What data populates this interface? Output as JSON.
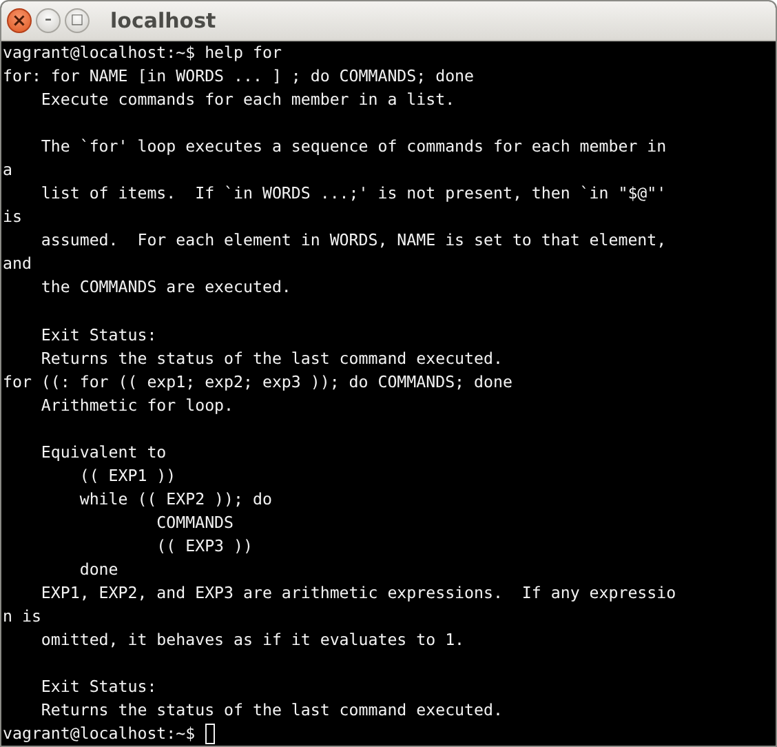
{
  "window": {
    "title": "localhost",
    "buttons": [
      {
        "kind": "close",
        "label": "×"
      },
      {
        "kind": "minimize",
        "label": "–"
      },
      {
        "kind": "maximize",
        "label": "□"
      }
    ]
  },
  "terminal": {
    "lines": [
      {
        "kind": "prompt",
        "text": "vagrant@localhost:~$ help for",
        "cursor": false
      },
      {
        "kind": "text",
        "text": "for: for NAME [in WORDS ... ] ; do COMMANDS; done"
      },
      {
        "kind": "text",
        "text": "    Execute commands for each member in a list."
      },
      {
        "kind": "blank"
      },
      {
        "kind": "text",
        "text": "    The `for' loop executes a sequence of commands for each member in"
      },
      {
        "kind": "text",
        "text": "a"
      },
      {
        "kind": "text",
        "text": "    list of items.  If `in WORDS ...;' is not present, then `in \"$@\"'"
      },
      {
        "kind": "text",
        "text": "is"
      },
      {
        "kind": "text",
        "text": "    assumed.  For each element in WORDS, NAME is set to that element,"
      },
      {
        "kind": "text",
        "text": "and"
      },
      {
        "kind": "text",
        "text": "    the COMMANDS are executed."
      },
      {
        "kind": "blank"
      },
      {
        "kind": "text",
        "text": "    Exit Status:"
      },
      {
        "kind": "text",
        "text": "    Returns the status of the last command executed."
      },
      {
        "kind": "text",
        "text": "for ((: for (( exp1; exp2; exp3 )); do COMMANDS; done"
      },
      {
        "kind": "text",
        "text": "    Arithmetic for loop."
      },
      {
        "kind": "blank"
      },
      {
        "kind": "text",
        "text": "    Equivalent to"
      },
      {
        "kind": "text",
        "text": "        (( EXP1 ))"
      },
      {
        "kind": "text",
        "text": "        while (( EXP2 )); do"
      },
      {
        "kind": "text",
        "text": "                COMMANDS"
      },
      {
        "kind": "text",
        "text": "                (( EXP3 ))"
      },
      {
        "kind": "text",
        "text": "        done"
      },
      {
        "kind": "text",
        "text": "    EXP1, EXP2, and EXP3 are arithmetic expressions.  If any expressio"
      },
      {
        "kind": "text",
        "text": "n is"
      },
      {
        "kind": "text",
        "text": "    omitted, it behaves as if it evaluates to 1."
      },
      {
        "kind": "blank"
      },
      {
        "kind": "text",
        "text": "    Exit Status:"
      },
      {
        "kind": "text",
        "text": "    Returns the status of the last command executed."
      },
      {
        "kind": "prompt",
        "text": "vagrant@localhost:~$ ",
        "cursor": true
      }
    ]
  }
}
